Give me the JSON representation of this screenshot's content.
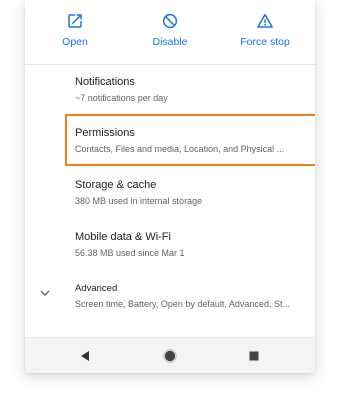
{
  "actions": {
    "open_label": "Open",
    "disable_label": "Disable",
    "force_stop_label": "Force stop"
  },
  "settings": [
    {
      "title": "Notifications",
      "summary": "~7 notifications per day"
    },
    {
      "title": "Permissions",
      "summary": "Contacts, Files and media, Location, and Physical ..."
    },
    {
      "title": "Storage & cache",
      "summary": "380 MB used in internal storage"
    },
    {
      "title": "Mobile data & Wi-Fi",
      "summary": "56.38 MB used since Mar 1"
    },
    {
      "title": "Advanced",
      "summary": "Screen time, Battery, Open by default, Advanced, St..."
    }
  ],
  "icons": {
    "open": "open-in-new-icon",
    "disable": "block-icon",
    "force_stop": "warning-icon",
    "advanced_expand": "chevron-down-icon",
    "back": "back-triangle-icon",
    "home": "home-circle-icon",
    "recents": "recents-square-icon"
  },
  "colors": {
    "accent": "#1a73e8",
    "highlight": "#f07f1a"
  }
}
